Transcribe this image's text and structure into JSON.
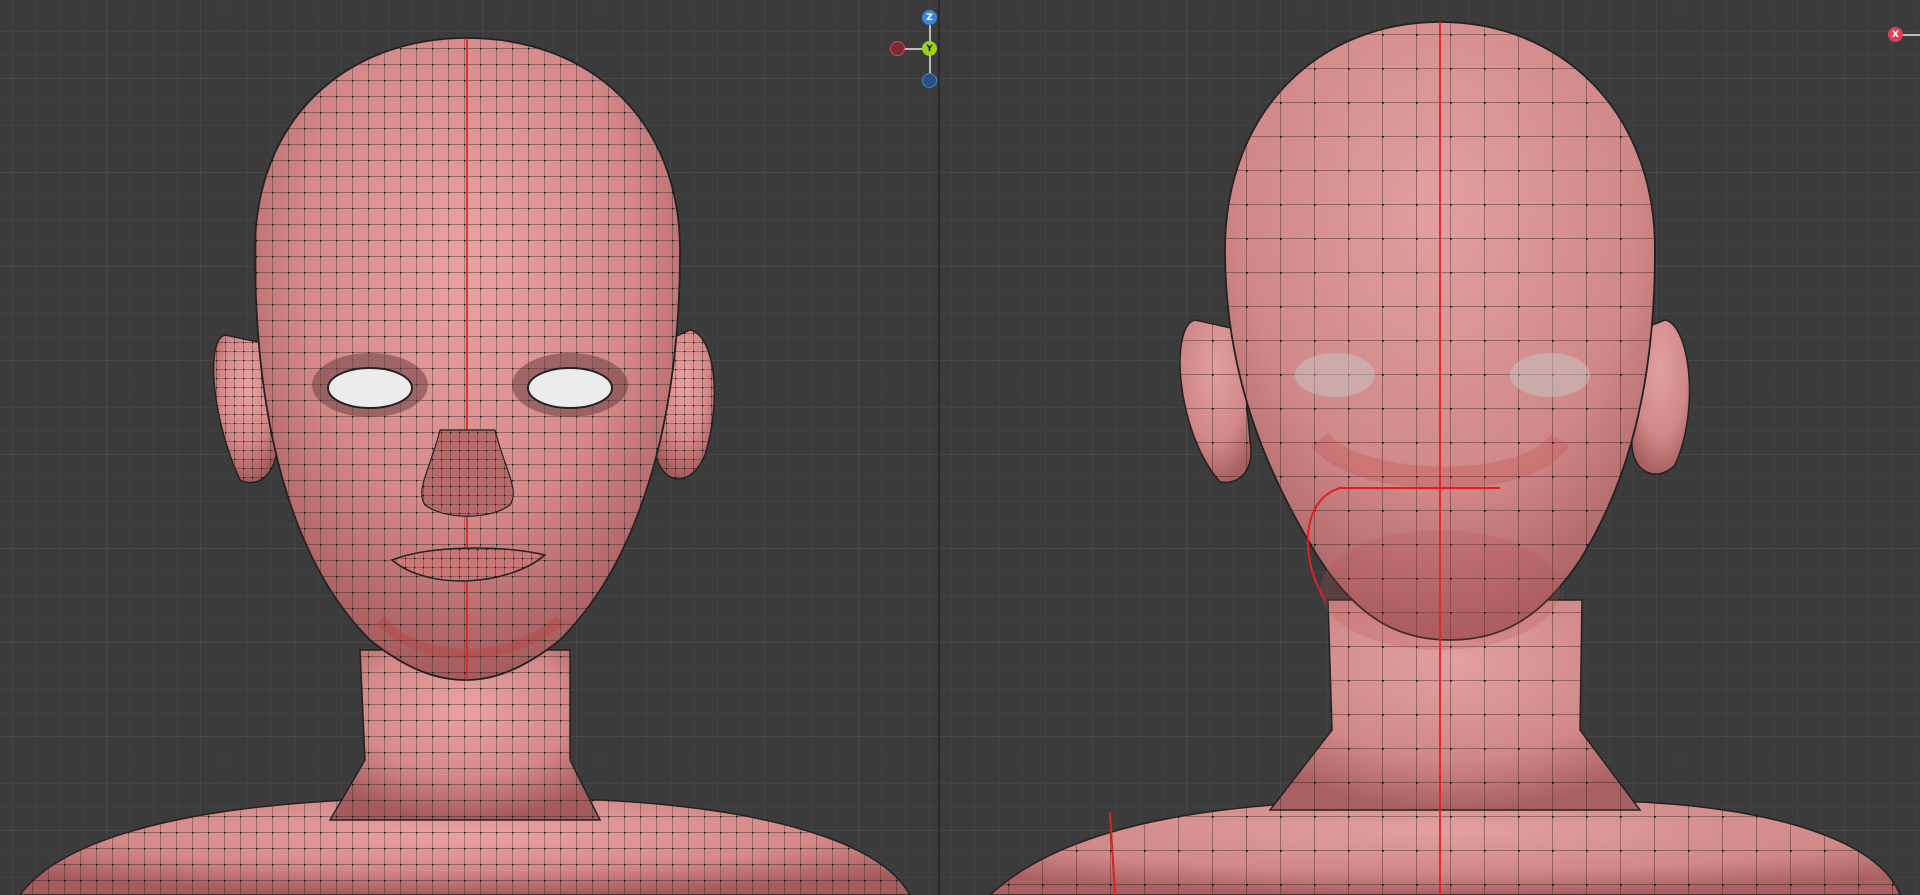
{
  "left_viewport": {
    "gizmo": {
      "z_label": "Z",
      "y_label": "Y"
    }
  },
  "right_viewport": {
    "gizmo": {
      "x_label": "X"
    }
  },
  "colors": {
    "background": "#3b3b3b",
    "grid": "#474747",
    "skin": "#d78e8e",
    "skin_shadow": "#a95f60",
    "wire": "#1e1414",
    "seam": "#e02020",
    "axis_x": "#e04055",
    "axis_y": "#9ad41a",
    "axis_z": "#3d86d8"
  }
}
